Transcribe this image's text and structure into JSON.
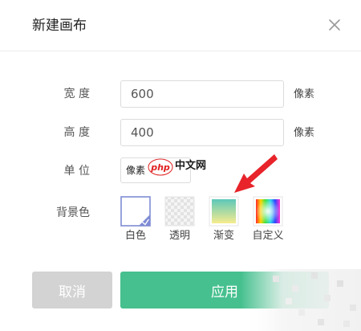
{
  "dialog": {
    "title": "新建画布",
    "close_icon": "close-icon"
  },
  "form": {
    "width": {
      "label": "宽 度",
      "value": "600",
      "unit": "像素"
    },
    "height": {
      "label": "高 度",
      "value": "400",
      "unit": "像素"
    },
    "unit": {
      "label": "单 位",
      "selected": "像素"
    },
    "background": {
      "label": "背景色",
      "options": [
        {
          "label": "白色",
          "selected": true
        },
        {
          "label": "透明",
          "selected": false
        },
        {
          "label": "渐变",
          "selected": false
        },
        {
          "label": "自定义",
          "selected": false
        }
      ]
    }
  },
  "buttons": {
    "cancel": "取消",
    "apply": "应用"
  },
  "watermark": {
    "text": "中文网",
    "logo": "php"
  },
  "colors": {
    "accent": "#46c08e",
    "cancel": "#d3d3d3",
    "arrow": "#e8232a",
    "selected_check": "#7f8cd4"
  }
}
